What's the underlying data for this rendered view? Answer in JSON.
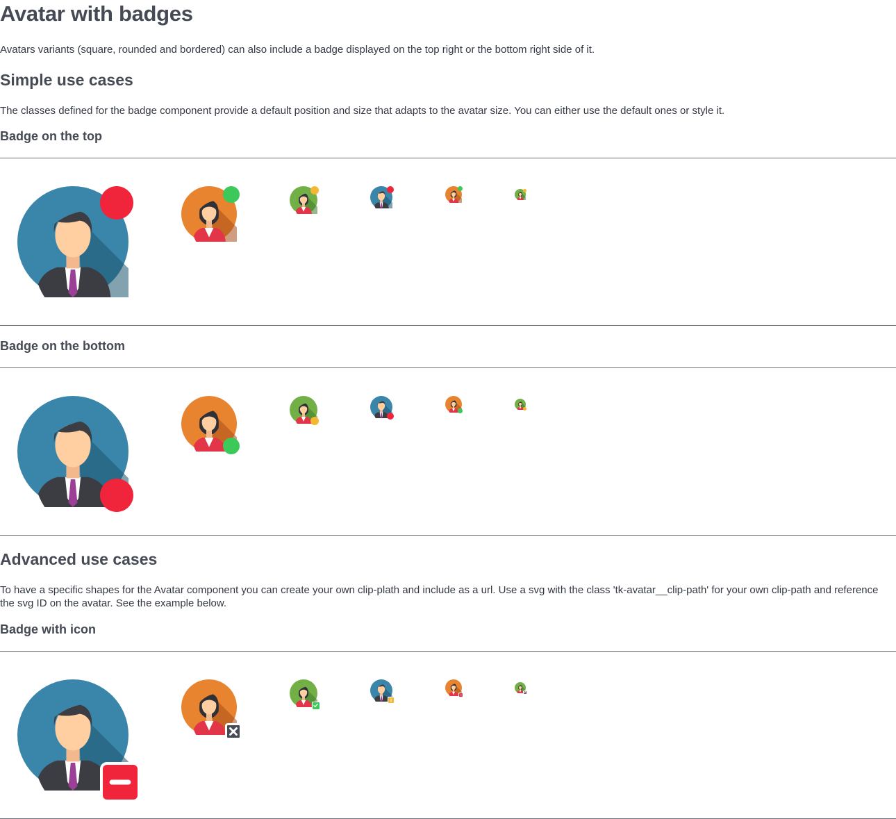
{
  "page": {
    "title": "Avatar with badges",
    "intro": "Avatars variants (square, rounded and bordered) can also include a badge displayed on the top right or the bottom right side of it."
  },
  "simple": {
    "heading": "Simple use cases",
    "description": "The classes defined for the badge component provide a default position and size that adapts to the avatar size. You can either use the default ones or style it.",
    "top_label": "Badge on the top",
    "bottom_label": "Badge on the bottom"
  },
  "advanced": {
    "heading": "Advanced use cases",
    "description": "To have a specific shapes for the Avatar component you can create your own clip-plath and include as a url. Use a svg with the class 'tk-avatar__clip-path' for your own clip-path and reference the svg ID on the avatar. See the example below.",
    "icon_label": "Badge with icon"
  },
  "avatars": [
    {
      "person": "man",
      "background": "blue",
      "badge_color": "#f0243a"
    },
    {
      "person": "woman",
      "background": "orange",
      "badge_color": "#3cc95a"
    },
    {
      "person": "woman",
      "background": "green",
      "badge_color": "#f3b833"
    },
    {
      "person": "man",
      "background": "blue",
      "badge_color": "#f0243a"
    },
    {
      "person": "woman",
      "background": "orange",
      "badge_color": "#3cc95a"
    },
    {
      "person": "woman",
      "background": "green",
      "badge_color": "#f3b833"
    }
  ],
  "icon_badges": [
    {
      "icon": "minus-icon",
      "color": "#f0243a"
    },
    {
      "icon": "close-icon",
      "color": "#454a54"
    },
    {
      "icon": "check-icon",
      "color": "#3cc95a"
    },
    {
      "icon": "info-icon",
      "color": "#f3b833"
    },
    {
      "icon": "minus-icon",
      "color": "#f0243a"
    },
    {
      "icon": "close-icon",
      "color": "#454a54"
    }
  ],
  "colors": {
    "text": "#454a54",
    "rule": "#6b6e74",
    "blue_bg": "#2f7597",
    "orange_bg": "#e07b2a",
    "green_bg": "#69a842"
  }
}
